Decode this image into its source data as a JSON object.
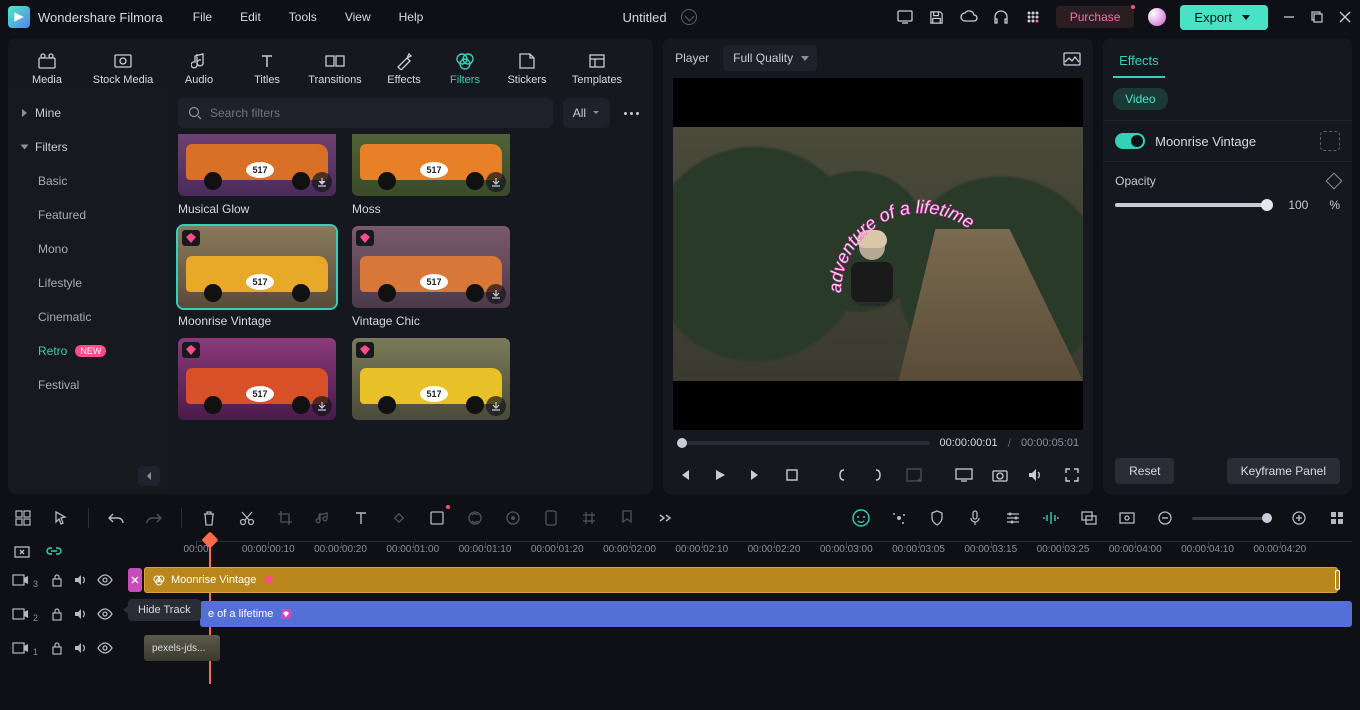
{
  "app": {
    "name": "Wondershare Filmora"
  },
  "menu": {
    "file": "File",
    "edit": "Edit",
    "tools": "Tools",
    "view": "View",
    "help": "Help"
  },
  "document": {
    "name": "Untitled"
  },
  "titlebar": {
    "purchase": "Purchase",
    "export": "Export"
  },
  "libTabs": {
    "media": "Media",
    "stock": "Stock Media",
    "audio": "Audio",
    "titles": "Titles",
    "transitions": "Transitions",
    "effects": "Effects",
    "filters": "Filters",
    "stickers": "Stickers",
    "templates": "Templates"
  },
  "libSide": {
    "mine": "Mine",
    "filters": "Filters",
    "subs": {
      "basic": "Basic",
      "featured": "Featured",
      "mono": "Mono",
      "lifestyle": "Lifestyle",
      "cinematic": "Cinematic",
      "retro": "Retro",
      "festival": "Festival"
    },
    "newBadge": "NEW"
  },
  "search": {
    "placeholder": "Search filters",
    "all": "All"
  },
  "thumbs": {
    "musical_glow": "Musical Glow",
    "moss": "Moss",
    "moonrise_vintage": "Moonrise Vintage",
    "vintage_chic": "Vintage Chic"
  },
  "player": {
    "tab": "Player",
    "quality": "Full Quality",
    "overlay_text": "adventure of a lifetime",
    "time_current": "00:00:00:01",
    "time_total": "00:00:05:01",
    "sep": "/"
  },
  "fx": {
    "tab": "Effects",
    "subTab": "Video",
    "name": "Moonrise Vintage",
    "opacity_label": "Opacity",
    "opacity_value": "100",
    "opacity_unit": "%",
    "reset": "Reset",
    "keyframe_panel": "Keyframe Panel"
  },
  "ruler_labels": [
    "00:00",
    "00:00:00:10",
    "00:00:00:20",
    "00:00:01:00",
    "00:00:01:10",
    "00:00:01:20",
    "00:00:02:00",
    "00:00:02:10",
    "00:00:02:20",
    "00:00:03:00",
    "00:00:03:05",
    "00:00:03:15",
    "00:00:03:25",
    "00:00:04:00",
    "00:00:04:10",
    "00:00:04:20"
  ],
  "timeline": {
    "tooltip": "Hide Track",
    "clip_fx": "Moonrise Vintage",
    "clip_title": "e of a lifetime",
    "clip_video": "pexels-jds..."
  }
}
